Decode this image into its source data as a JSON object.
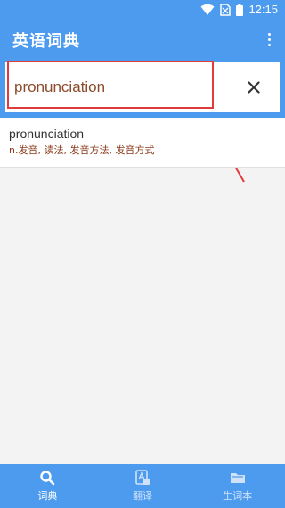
{
  "status_bar": {
    "time": "12:15"
  },
  "app_bar": {
    "title": "英语词典"
  },
  "search": {
    "value": "pronunciation",
    "placeholder": ""
  },
  "results": [
    {
      "word": "pronunciation",
      "definition": "n.发音, 读法, 发音方法, 发音方式"
    }
  ],
  "bottom_nav": [
    {
      "label": "词典",
      "icon": "search-icon",
      "active": true
    },
    {
      "label": "翻译",
      "icon": "translate-icon",
      "active": false
    },
    {
      "label": "生词本",
      "icon": "folder-icon",
      "active": false
    }
  ],
  "colors": {
    "primary": "#4d9bee",
    "definition": "#8b3a1a",
    "annotation": "#e03c3c"
  }
}
